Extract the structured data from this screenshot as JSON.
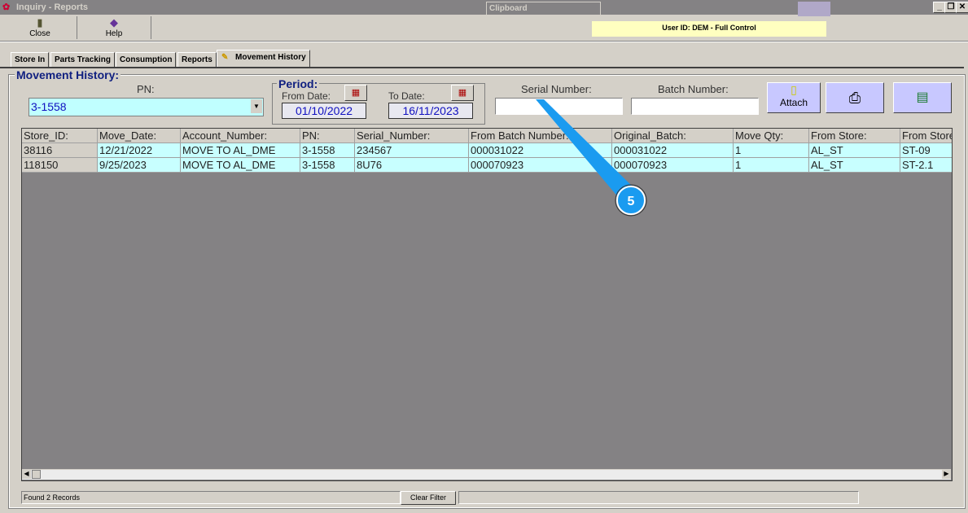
{
  "window": {
    "title": "Inquiry - Reports",
    "clipboard": "Clipboard",
    "min": "_",
    "restore": "❐",
    "close": "✕"
  },
  "toolbar": {
    "close_label": "Close",
    "help_label": "Help"
  },
  "user_banner": "User ID: DEM - Full Control",
  "tabs": [
    {
      "label": "Store In"
    },
    {
      "label": "Parts Tracking"
    },
    {
      "label": "Consumption"
    },
    {
      "label": "Reports"
    },
    {
      "label": "Movement History"
    }
  ],
  "panel": {
    "title": "Movement History:",
    "pn_label": "PN:",
    "pn_value": "3-1558",
    "period_label": "Period:",
    "from_label": "From Date:",
    "from_value": "01/10/2022",
    "to_label": "To Date:",
    "to_value": "16/11/2023",
    "serial_label": "Serial Number:",
    "serial_value": "",
    "batch_label": "Batch Number:",
    "batch_value": "",
    "attach_label": "Attach"
  },
  "table": {
    "columns": [
      "Store_ID:",
      "Move_Date:",
      "Account_Number:",
      "PN:",
      "Serial_Number:",
      "From Batch Number:",
      "Original_Batch:",
      "Move Qty:",
      "From Store:",
      "From Store"
    ],
    "rows": [
      [
        "38116",
        "12/21/2022",
        "MOVE TO AL_DME",
        "3-1558",
        "234567",
        "000031022",
        "000031022",
        "1",
        "AL_ST",
        "ST-09"
      ],
      [
        "118150",
        "9/25/2023",
        "MOVE TO AL_DME",
        "3-1558",
        "8U76",
        "000070923",
        "000070923",
        "1",
        "AL_ST",
        "ST-2.1"
      ]
    ]
  },
  "status": {
    "records": "Found 2 Records",
    "clear_filter": "Clear Filter"
  },
  "callout": {
    "number": "5",
    "color": "#1a9bf0"
  }
}
